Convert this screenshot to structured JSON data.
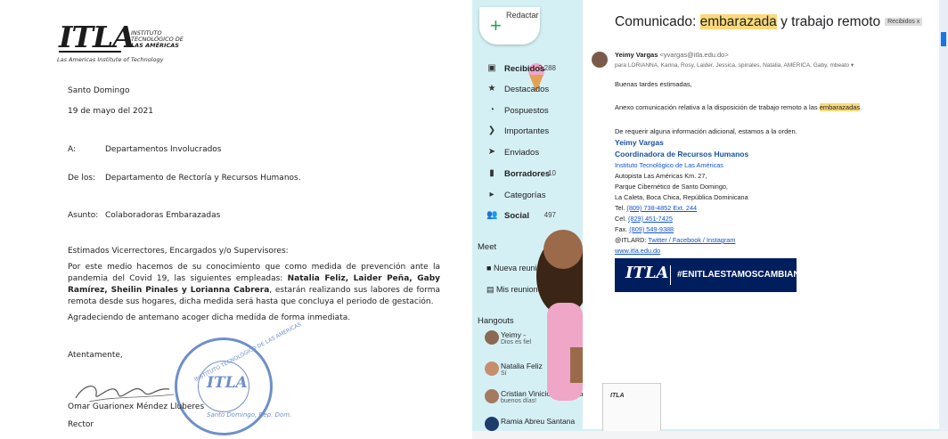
{
  "letter": {
    "logo": "ITLA",
    "logo_small": [
      "INSTITUTO",
      "TECNOLÓGICO DE",
      "LAS AMÉRICAS"
    ],
    "logo_tagline": "Las Americas Institute of Technology",
    "city": "Santo Domingo",
    "date": "19 de mayo del 2021",
    "to_label": "A:",
    "to_value": "Departamentos Involucrados",
    "from_label": "De los:",
    "from_value": "Departamento de Rectoría y Recursos Humanos.",
    "subject_label": "Asunto:",
    "subject_value": "Colaboradoras Embarazadas",
    "greeting": "Estimados Vicerrectores, Encargados y/o Supervisores:",
    "para1_a": "Por este medio hacemos de su conocimiento que como medida de prevención ante la pandemia del Covid 19, las siguientes empleadas: ",
    "para1_names": "Natalia Feliz, Laider Peña, Gaby Ramírez, Sheilin Pinales y Lorianna Cabrera",
    "para1_b": ", estarán realizando sus labores de forma remota desde sus hogares, dicha medida será hasta que concluya el periodo de gestación.",
    "para2": "Agradeciendo de antemano acoger dicha medida de forma inmediata.",
    "closing": "Atentamente,",
    "signer_name": "Omar Guarionex Méndez Lluberes",
    "signer_title": "Rector",
    "stamp_top": "INSTITUTO TECNOLÓGICO DE LAS AMÉRICAS",
    "stamp_logo": "ITLA",
    "stamp_bottom": "Santo Domingo, Rep. Dom."
  },
  "gmail": {
    "compose_label": "Redactar",
    "nav": [
      {
        "icon": "inbox-icon",
        "label": "Recibidos",
        "count": "2,288",
        "bold": true
      },
      {
        "icon": "star-icon",
        "label": "Destacados",
        "count": ""
      },
      {
        "icon": "clock-icon",
        "label": "Pospuestos",
        "count": ""
      },
      {
        "icon": "important-icon",
        "label": "Importantes",
        "count": ""
      },
      {
        "icon": "send-icon",
        "label": "Enviados",
        "count": ""
      },
      {
        "icon": "draft-icon",
        "label": "Borradores",
        "count": "10",
        "bold": true
      },
      {
        "icon": "label-icon",
        "label": "Categorías",
        "count": ""
      },
      {
        "icon": "social-icon",
        "label": "Social",
        "count": "497",
        "bold": true
      }
    ],
    "meet_title": "Meet",
    "meet_new": "Nueva reunión",
    "meet_mine": "Mis reuniones",
    "hangouts_title": "Hangouts",
    "hangouts": [
      {
        "name": "Yeimy -",
        "status": "Dios es fiel"
      },
      {
        "name": "Natalia Feliz",
        "status": "Sí"
      },
      {
        "name": "Cristian Vinicio De Moya Aristy",
        "status": "buenos días!"
      },
      {
        "name": "Ramia Abreu Santana",
        "status": ""
      }
    ],
    "subject_pre": "Comunicado: ",
    "subject_hl": "embarazada",
    "subject_post": " y trabajo remoto",
    "subject_badge": "Recibidos x",
    "sender_name": "Yeimy Vargas",
    "sender_email": "<yvargas@itla.edu.do>",
    "to_line": "para LORIANNA, Karina, Rosy, Laider, Jessica, spinales, Natalia, AMERICA, Gaby, mbeato ▾",
    "greeting": "Buenas tardes estimadas,",
    "body_pre": "Anexo comunicación relativa a la disposición de trabajo remoto a las ",
    "body_hl": "embarazadas",
    "body_post": ".",
    "body2": "De requerir alguna información adicional, estamos a la orden.",
    "sig_name": "Yeimy Vargas",
    "sig_role": "Coordinadora de Recursos Humanos",
    "sig_inst": "Instituto Tecnológico de Las Américas",
    "sig_addr1": "Autopista Las Américas Km. 27,",
    "sig_addr2": "Parque Cibernético de Santo Domingo,",
    "sig_addr3": "La Caleta, Boca Chica, República Dominicana",
    "sig_tel_label": "Tel. ",
    "sig_tel": "(809) 738-4852 Ext. 244",
    "sig_cel_label": "Cel. ",
    "sig_cel": "(829) 451-7425",
    "sig_fax_label": "Fax. ",
    "sig_fax": "(809) 549-9388",
    "sig_social_label": "@ITLARD: ",
    "sig_social": "Twitter / Facebook / Instagram",
    "sig_web": "www.itla.edu.do",
    "banner_logo": "ITLA",
    "banner_text": "#ENITLAESTAMOSCAMBIANDO",
    "attachment_logo": "ITLA"
  }
}
